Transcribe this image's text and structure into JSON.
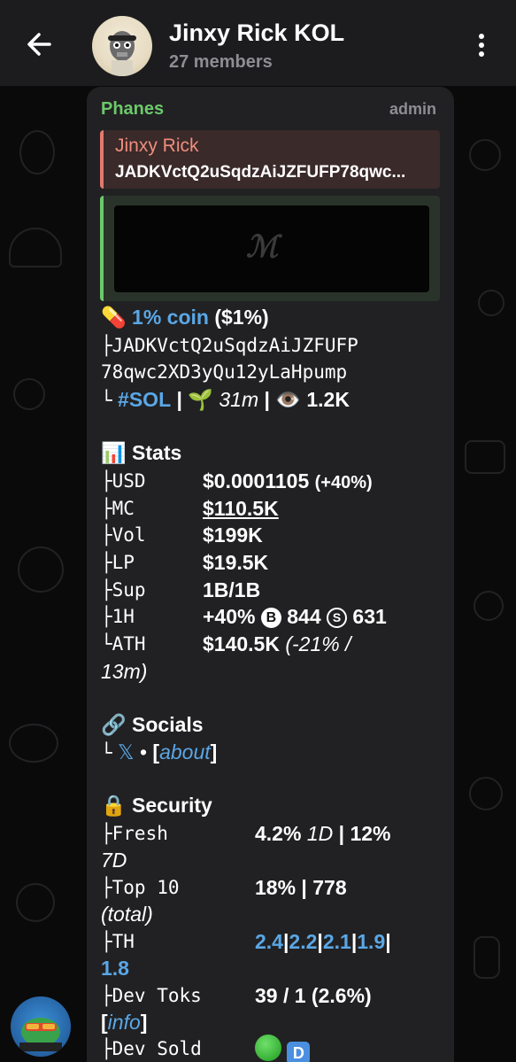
{
  "header": {
    "title": "Jinxy Rick KOL",
    "members": "27 members"
  },
  "message": {
    "sender": "Phanes",
    "role": "admin",
    "reply": {
      "name": "Jinxy Rick",
      "text": "JADKVctQ2uSqdzAiJZFUFP78qwc..."
    },
    "preview_logo": "ℳ",
    "coin": {
      "name": "1% coin",
      "ticker": "($1%)",
      "address_line1": "├JADKVctQ2uSqdzAiJZFUFP",
      "address_line2": "78qwc2XD3yQu12yLaHpump",
      "chain_prefix": "└",
      "chain": "#SOL",
      "age": "31m",
      "views": "1.2K"
    },
    "stats": {
      "heading": "Stats",
      "rows": [
        {
          "label": "├USD",
          "value": "$0.0001105",
          "extra": "(+40%)"
        },
        {
          "label": "├MC",
          "value": "$110.5K"
        },
        {
          "label": "├Vol",
          "value": "$199K"
        },
        {
          "label": "├LP",
          "value": "$19.5K"
        },
        {
          "label": "├Sup",
          "value": "1B/1B"
        },
        {
          "label": "├1H",
          "value": "+40%",
          "buys": "844",
          "sells": "631"
        },
        {
          "label": "└ATH",
          "value": "$140.5K",
          "change": "(-21% /",
          "change2": "13m)"
        }
      ]
    },
    "socials": {
      "heading": "Socials",
      "prefix": "└",
      "x": "𝕏",
      "sep": "•",
      "about_open": "[",
      "about": "about",
      "about_close": "]"
    },
    "security": {
      "heading": "Security",
      "fresh_label": "├Fresh",
      "fresh_value": "4.2%",
      "fresh_1d": "1D",
      "fresh_sep": "|",
      "fresh_value2": "12%",
      "fresh_7d": "7D",
      "top10_label": "├Top 10",
      "top10_value": "18% | 778",
      "top10_total": "(total)",
      "th_label": "├TH",
      "th_values": [
        "2.4",
        "2.2",
        "2.1",
        "1.9"
      ],
      "th_last": "1.8",
      "devtoks_label": "├Dev Toks",
      "devtoks_value": "39 / 1 (2.6%)",
      "info_open": "[",
      "info": "info",
      "info_close": "]",
      "devsold_label": "├Dev Sold",
      "devsold_badge": "D"
    }
  },
  "icons": {
    "back": "arrow-left-icon",
    "menu": "more-vertical-icon",
    "pill": "💊",
    "seedling": "🌱",
    "eye": "👁️",
    "chart": "📊",
    "link": "🔗",
    "lock": "🔒"
  }
}
